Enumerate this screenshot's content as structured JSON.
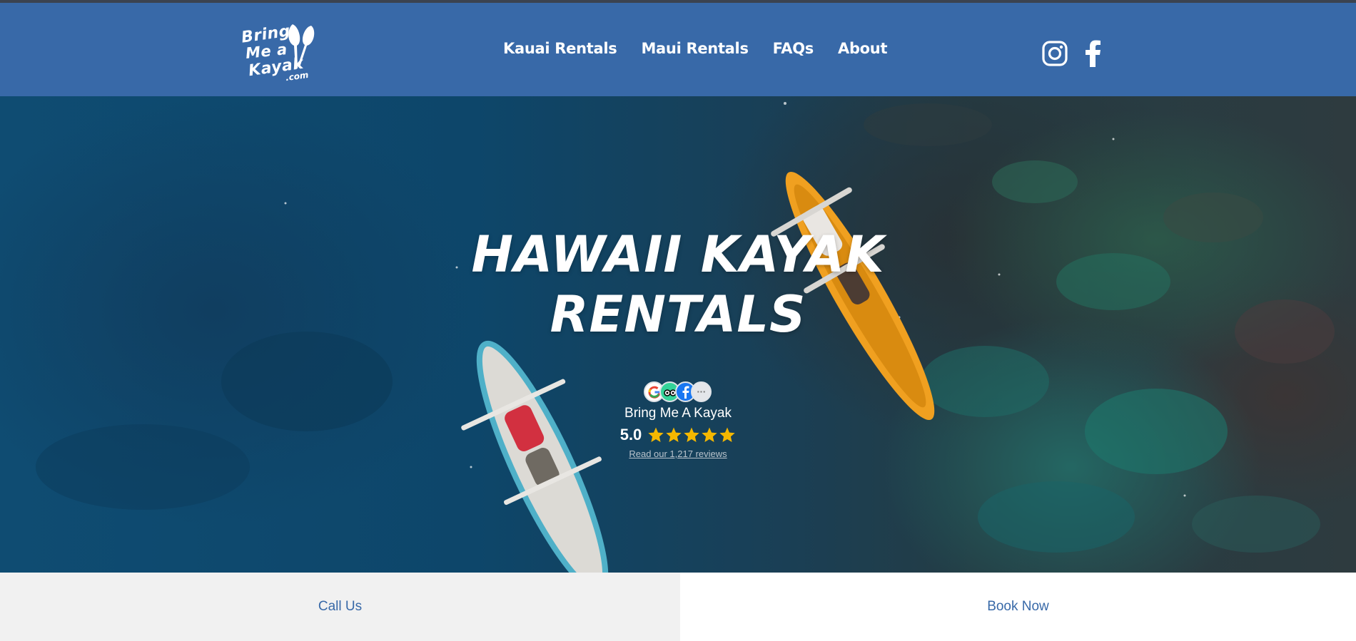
{
  "header": {
    "logo": {
      "line1": "Bring",
      "line2": "Me a",
      "line3": "Kayak",
      "suffix": ".com"
    },
    "nav": [
      {
        "label": "Kauai Rentals"
      },
      {
        "label": "Maui Rentals"
      },
      {
        "label": "FAQs"
      },
      {
        "label": "About"
      }
    ],
    "social": [
      {
        "icon": "instagram-icon"
      },
      {
        "icon": "facebook-icon"
      }
    ]
  },
  "hero": {
    "title_line1": "HAWAII KAYAK",
    "title_line2": "RENTALS"
  },
  "review_widget": {
    "sources": [
      "google-icon",
      "tripadvisor-icon",
      "facebook-icon",
      "more-icon"
    ],
    "more_label": "···",
    "business_name": "Bring Me A Kayak",
    "score": "5.0",
    "stars": 5,
    "link_text": "Read our 1,217 reviews"
  },
  "actions": {
    "call_label": "Call Us",
    "book_label": "Book Now"
  },
  "colors": {
    "header_bg": "#3869a8",
    "accent_text": "#3869a8",
    "star": "#f5b800"
  }
}
